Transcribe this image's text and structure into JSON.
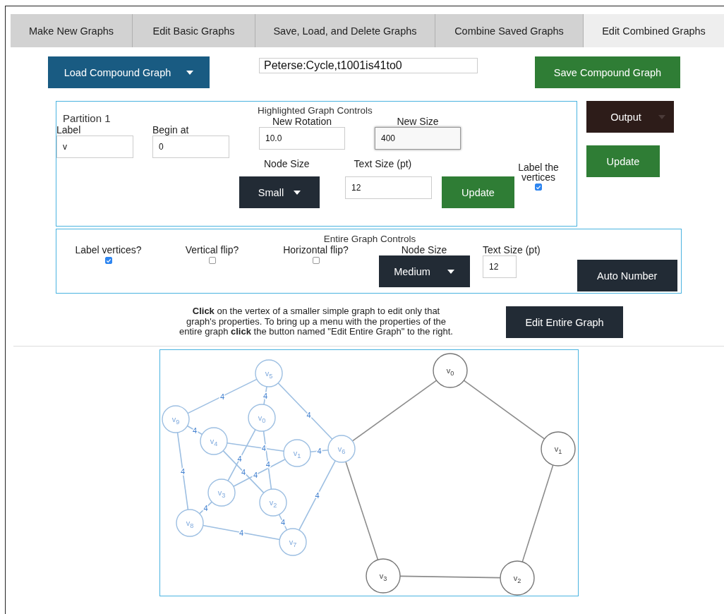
{
  "tabs": [
    {
      "label": "Make New Graphs",
      "selected": false
    },
    {
      "label": "Edit Basic Graphs",
      "selected": false
    },
    {
      "label": "Save, Load, and Delete Graphs",
      "selected": false
    },
    {
      "label": "Combine Saved Graphs",
      "selected": false
    },
    {
      "label": "Edit Combined Graphs",
      "selected": true
    }
  ],
  "toolbar": {
    "load_button": "Load Compound Graph",
    "graph_name": "Peterse:Cycle,t1001is41to0",
    "save_button": "Save Compound Graph"
  },
  "highlighted_controls": {
    "partition_title": "Partition 1",
    "title": "Highlighted Graph Controls",
    "label_field": {
      "label": "Label",
      "value": "v"
    },
    "begin_field": {
      "label": "Begin at",
      "value": "0"
    },
    "rotation_field": {
      "label": "New Rotation",
      "value": "10.0"
    },
    "size_field": {
      "label": "New Size",
      "value": "400",
      "focused": true
    },
    "node_size": {
      "label": "Node Size",
      "value": "Small"
    },
    "text_size": {
      "label": "Text Size (pt)",
      "value": "12"
    },
    "update_button": "Update",
    "label_vertices": {
      "label": "Label the vertices",
      "checked": true
    }
  },
  "side_buttons": {
    "output_button": "Output",
    "update_button": "Update"
  },
  "entire_controls": {
    "title": "Entire Graph Controls",
    "checkboxes": [
      {
        "label": "Label vertices?",
        "checked": true
      },
      {
        "label": "Vertical flip?",
        "checked": false
      },
      {
        "label": "Horizontal flip?",
        "checked": false
      }
    ],
    "node_size": {
      "label": "Node Size",
      "value": "Medium"
    },
    "text_size": {
      "label": "Text Size (pt)",
      "value": "12"
    },
    "auto_number_button": "Auto Number"
  },
  "instructions": "**Click** on the vertex of a smaller simple graph to edit only that graph's properties. To bring up a menu with the properties of the entire graph **click** the button named \"Edit Entire Graph\" to the right.",
  "edit_entire_button": "Edit Entire Graph",
  "graph": {
    "nodes": [
      {
        "label": "v$_{0}$",
        "highlighted": true
      },
      {
        "label": "v$_{1}$",
        "highlighted": true
      },
      {
        "label": "v$_{2}$",
        "highlighted": true
      },
      {
        "label": "v$_{3}$",
        "highlighted": true
      },
      {
        "label": "v$_{4}$",
        "highlighted": true
      },
      {
        "label": "v$_{5}$",
        "highlighted": true
      },
      {
        "label": "v$_{6}$",
        "highlighted": true
      },
      {
        "label": "v$_{7}$",
        "highlighted": true
      },
      {
        "label": "v$_{8}$",
        "highlighted": true
      },
      {
        "label": "v$_{9}$",
        "highlighted": true
      },
      {
        "label": "v$_{0}$",
        "highlighted": false
      },
      {
        "label": "v$_{1}$",
        "highlighted": false
      },
      {
        "label": "v$_{2}$",
        "highlighted": false
      },
      {
        "label": "v$_{3}$",
        "highlighted": false
      }
    ],
    "edges": [
      {
        "label": "4",
        "highlighted": true
      },
      {
        "label": "4",
        "highlighted": true
      },
      {
        "label": "4",
        "highlighted": true
      },
      {
        "label": "4",
        "highlighted": true
      },
      {
        "label": "4",
        "highlighted": true
      },
      {
        "label": "4",
        "highlighted": true
      },
      {
        "label": "4",
        "highlighted": true
      },
      {
        "label": "4",
        "highlighted": true
      },
      {
        "label": "4",
        "highlighted": true
      },
      {
        "label": "4",
        "highlighted": true
      },
      {
        "label": "4",
        "highlighted": true
      },
      {
        "label": "4",
        "highlighted": true
      },
      {
        "label": "4",
        "highlighted": true
      },
      {
        "label": "4",
        "highlighted": true
      },
      {
        "label": "4",
        "highlighted": true
      },
      {
        "highlighted": false
      },
      {
        "highlighted": false
      },
      {
        "highlighted": false
      },
      {
        "highlighted": false
      },
      {
        "highlighted": false
      }
    ]
  }
}
